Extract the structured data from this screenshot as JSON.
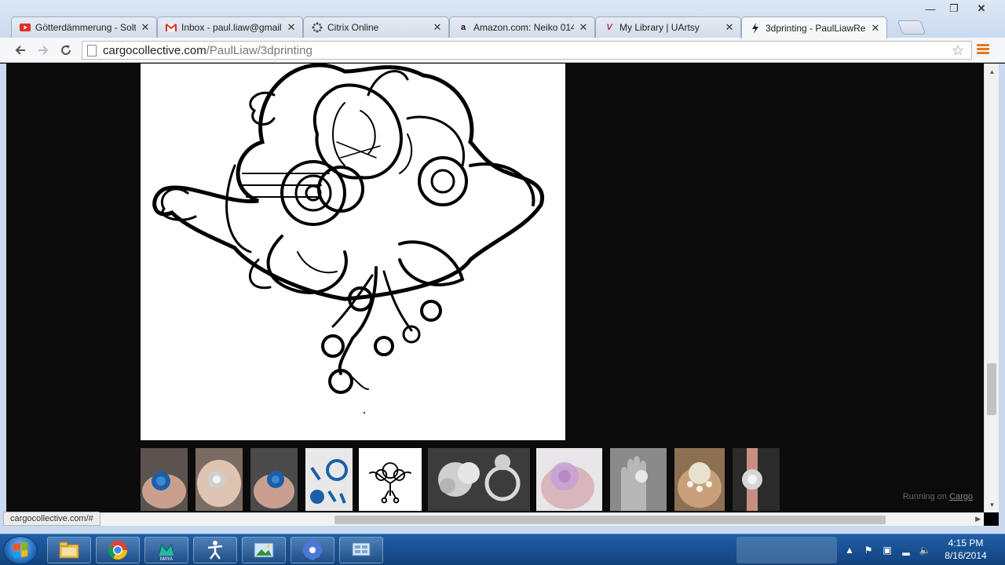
{
  "browser": {
    "tabs": [
      {
        "title": "Götterdämmerung - Solt",
        "favicon": "youtube-icon",
        "active": false
      },
      {
        "title": "Inbox - paul.liaw@gmail",
        "favicon": "gmail-icon",
        "active": false
      },
      {
        "title": "Citrix Online",
        "favicon": "citrix-icon",
        "active": false
      },
      {
        "title": "Amazon.com: Neiko 014",
        "favicon": "amazon-icon",
        "active": false
      },
      {
        "title": "My Library | UArtsy",
        "favicon": "uartsy-icon",
        "active": false
      },
      {
        "title": "3dprinting - PaulLiawRe",
        "favicon": "cargo-bolt-icon",
        "active": true
      }
    ],
    "address": {
      "host": "cargocollective.com",
      "path": "/PaulLiaw/3dprinting"
    },
    "status_url": "cargocollective.com/#"
  },
  "page": {
    "footer_prefix": "Running on",
    "footer_link": "Cargo",
    "thumbnails": [
      {
        "subject": "blue ring on hand",
        "active": false
      },
      {
        "subject": "silver ring on hand",
        "active": false
      },
      {
        "subject": "blue ring on hand",
        "active": false
      },
      {
        "subject": "blue printed parts",
        "active": false
      },
      {
        "subject": "flower sketch",
        "active": true
      },
      {
        "subject": "render of ring",
        "active": false
      },
      {
        "subject": "pink translucent ring",
        "active": false
      },
      {
        "subject": "ring on gray hand",
        "active": false
      },
      {
        "subject": "gold ring with pearls",
        "active": false
      },
      {
        "subject": "ring on finger",
        "active": false
      }
    ]
  },
  "taskbar": {
    "apps": [
      "file-explorer-icon",
      "chrome-icon",
      "maya-icon",
      "zbrush-icon",
      "photo-viewer-icon",
      "flower-app-icon",
      "control-panel-icon"
    ],
    "maya_label": "MAYA",
    "clock_time": "4:15 PM",
    "clock_date": "8/16/2014"
  },
  "colors": {
    "page_bg": "#0b0b0b",
    "taskbar": "#1a4f8f",
    "chrome_accent": "#e07a1f"
  }
}
